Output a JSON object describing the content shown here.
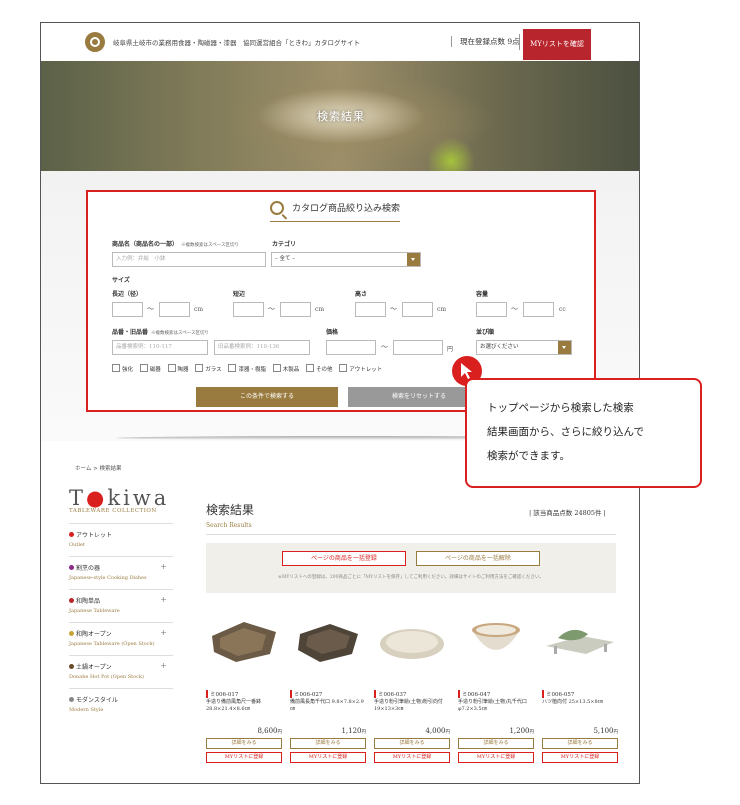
{
  "header": {
    "site_title": "岐阜県土岐市の業務用食器・陶磁器・漆器　協同運営組合「ときわ」カタログサイト",
    "count_label": "現在登録点数",
    "count_value": "9点",
    "mylist_button": "MYリストを確認"
  },
  "hero": {
    "title": "検索結果"
  },
  "search": {
    "title": "カタログ商品絞り込み検索",
    "name_label": "商品名（商品名の一部）",
    "name_note": "※複数検索はスペース区切り",
    "name_placeholder": "入力例：弁絵　小鉢",
    "category_label": "カテゴリ",
    "category_value": "– 全て –",
    "size_label": "サイズ",
    "long_side": "長辺（径）",
    "short_side": "短辺",
    "height": "高さ",
    "capacity": "容量",
    "unit_cm": "cm",
    "unit_cc": "cc",
    "tilde": "〜",
    "code_label": "品番・旧品番",
    "code_note": "※複数検索はスペース区切り",
    "code_placeholder": "品番検索例：110-117",
    "oldcode_placeholder": "旧品番検索例：110-136",
    "price_label": "価格",
    "unit_yen": "円",
    "sort_label": "並び順",
    "sort_value": "お選びください",
    "checkboxes": [
      "強化",
      "磁器",
      "陶器",
      "ガラス",
      "漆器・樹脂",
      "木製品",
      "その他",
      "アウトレット"
    ],
    "search_button": "この条件で検索する",
    "reset_button": "検索をリセットする"
  },
  "callout": {
    "line1": "トップページから検索した検索",
    "line2": "結果画面から、さらに絞り込んで",
    "line3": "検索ができます。"
  },
  "breadcrumb": "ホーム > 検索結果",
  "sidebar": {
    "brand_pre": "T",
    "brand_dot": "●",
    "brand_post": "kiwa",
    "brand_sub": "TABLEWARE COLLECTION",
    "categories": [
      {
        "ja": "アウトレット",
        "en": "Outlet",
        "color": "#d9201f",
        "plus": ""
      },
      {
        "ja": "割烹の器",
        "en": "Japanese-style Cooking Dishes",
        "color": "#8a2a86",
        "plus": "+"
      },
      {
        "ja": "和陶単品",
        "en": "Japanese Tableware",
        "color": "#b8252d",
        "plus": "+"
      },
      {
        "ja": "和陶オープン",
        "en": "Japanese Tableware (Open Stock)",
        "color": "#c8a437",
        "plus": "+"
      },
      {
        "ja": "土鍋オープン",
        "en": "Donabe Hot Pot (Open Stock)",
        "color": "#6b4a2a",
        "plus": "+"
      },
      {
        "ja": "モダンスタイル",
        "en": "Modern Style",
        "color": "#888888",
        "plus": ""
      }
    ]
  },
  "results": {
    "title": "検索結果",
    "subtitle": "Search Results",
    "count": "| 該当商品点数 24805件 |",
    "register_all": "ページの商品を一括登録",
    "unregister_all": "ページの商品を一括解除",
    "notice": "※MYリストへの登録は、200商品ごとに「MYリストを保存」してご利用ください。詳細はサイトのご利用方法をご確認ください。"
  },
  "products": [
    {
      "code": "ミ006-017",
      "name": "手造り備前風角尺一番鉢 28.8×21.4×8.6㎝",
      "price": "8,600",
      "img": "#6b5a45"
    },
    {
      "code": "ミ006-027",
      "name": "備前風長角千代口 9.8×7.8×2.9㎝",
      "price": "1,120",
      "img": "#4f4438"
    },
    {
      "code": "ミ006-037",
      "name": "手造り粉引筆絵(土物)粉引向付 19×13×3㎝",
      "price": "4,000",
      "img": "#e3ddd0"
    },
    {
      "code": "ミ006-047",
      "name": "手造り粉引筆絵(土物)丸千代口 φ7.2×3.5㎝",
      "price": "1,200",
      "img": "#ece8df"
    },
    {
      "code": "ミ006-057",
      "name": "ハツ植向付 25×13.5×8㎝",
      "price": "5,100",
      "img": "#9fae96"
    }
  ],
  "product_buttons": {
    "detail": "詳細をみる",
    "register": "MYリストに登録",
    "yen": "円"
  }
}
